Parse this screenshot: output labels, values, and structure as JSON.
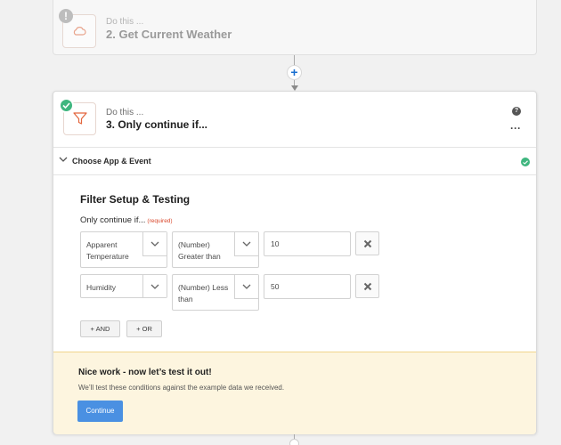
{
  "step2": {
    "subtitle": "Do this ...",
    "title": "2. Get Current Weather",
    "badge": "!"
  },
  "connector": {
    "add_symbol": "+"
  },
  "step3": {
    "subtitle": "Do this ...",
    "title": "3. Only continue if...",
    "help_symbol": "?",
    "more_symbol": "⋮",
    "accordion_label": "Choose App & Event",
    "section_title": "Filter Setup & Testing",
    "condition_label": "Only continue if...",
    "required_tag": "(required)",
    "conditions": [
      {
        "field": "Apparent Temperature",
        "operator": "(Number) Greater than",
        "value": "10"
      },
      {
        "field": "Humidity",
        "operator": "(Number) Less than",
        "value": "50"
      }
    ],
    "and_label": "+ AND",
    "or_label": "+ OR"
  },
  "notice": {
    "title": "Nice work - now let’s test it out!",
    "text": "We’ll test these conditions against the example data we received.",
    "button_label": "Continue"
  },
  "colors": {
    "success": "#3fb67f",
    "primary_button": "#4a90e2",
    "notice_bg": "#fdf5df",
    "required": "#d9472b",
    "plus_icon": "#1a6fd0"
  },
  "icons": {
    "step2_app": "weather-cloud-icon",
    "step3_app": "filter-funnel-icon",
    "status": "check-circle-icon",
    "remove": "close-x-icon"
  }
}
